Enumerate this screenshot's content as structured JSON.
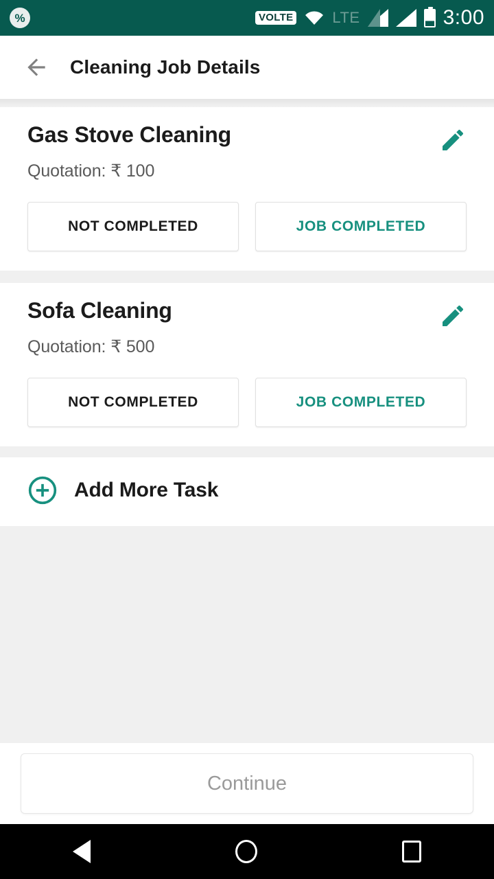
{
  "statusbar": {
    "left_icon": "percent-badge-icon",
    "volte_label": "VOLTE",
    "wifi_icon": "wifi-icon",
    "network_label": "LTE",
    "signal1_icon": "signal-bars-icon",
    "signal2_icon": "signal-bars-icon",
    "battery_icon": "battery-icon",
    "time": "3:00",
    "background_color": "#075a4f"
  },
  "appbar": {
    "back_icon": "arrow-back-icon",
    "title": "Cleaning Job Details"
  },
  "theme": {
    "accent_color": "#17907f",
    "page_background": "#f0f0f0",
    "card_background": "#ffffff"
  },
  "tasks": [
    {
      "title": "Gas Stove Cleaning",
      "quotation": "Quotation: ₹ 100",
      "edit_icon": "pencil-edit-icon",
      "not_completed_label": "NOT COMPLETED",
      "job_completed_label": "JOB COMPLETED"
    },
    {
      "title": "Sofa Cleaning",
      "quotation": "Quotation: ₹ 500",
      "edit_icon": "pencil-edit-icon",
      "not_completed_label": "NOT COMPLETED",
      "job_completed_label": "JOB COMPLETED"
    }
  ],
  "add_more": {
    "icon": "plus-circle-icon",
    "label": "Add More Task"
  },
  "footer": {
    "continue_label": "Continue"
  },
  "navbar": {
    "back": "nav-back-icon",
    "home": "nav-home-icon",
    "recents": "nav-recents-icon"
  }
}
